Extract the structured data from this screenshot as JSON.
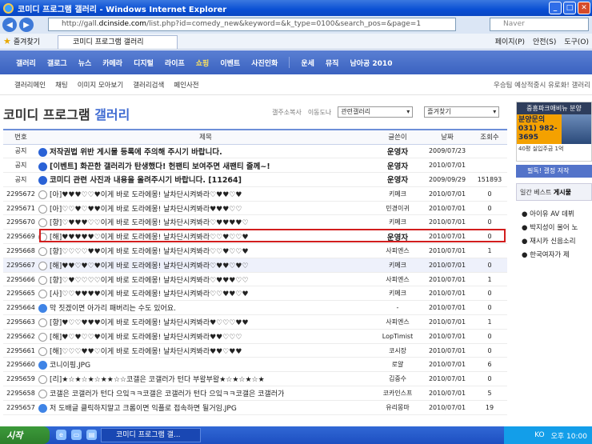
{
  "window": {
    "title": "코미디 프로그램 갤러리 - Windows Internet Explorer"
  },
  "browser": {
    "url_prefix": "http://gall.",
    "url_domain": "dcinside.com",
    "url_rest": "/list.php?id=comedy_new&keyword=&k_type=0100&search_pos=&page=1",
    "search_placeholder": "Naver",
    "favorites_label": "즐겨찾기",
    "tab_title": "코미디 프로그램 갤러리",
    "tools": [
      "페이지(P)",
      "안전(S)",
      "도구(O)"
    ]
  },
  "site_nav": {
    "items": [
      "갤러리",
      "갤로그",
      "뉴스",
      "카메라",
      "디지털",
      "라이프",
      "쇼핑",
      "이벤트",
      "사진인화",
      "운세",
      "뮤직",
      "남아공 2010"
    ],
    "highlight": "쇼핑"
  },
  "sub_nav": {
    "items": [
      "갤러리메인",
      "채팅",
      "이미지 모아보기",
      "갤러리검색",
      "페인사전"
    ],
    "right_text": "우승팀 예상적중시 유로화! 갤러리"
  },
  "gallery": {
    "title_part1": "코미디 프로그램 ",
    "title_part2": "갤러리",
    "tool_a": "갤주소복사",
    "tool_b": "이동도나",
    "related_select": "관련갤러리",
    "fav_select": "즐겨찾기"
  },
  "table": {
    "headers": [
      "번호",
      "제목",
      "글쓴이",
      "날짜",
      "조회수"
    ],
    "rows": [
      {
        "num": "공지",
        "icon": "notice",
        "subject": "저작권법 위반 게시물 등록에 주의해 주시기 바랍니다.",
        "author": "운영자",
        "date": "2009/07/23",
        "views": "",
        "notice": true
      },
      {
        "num": "공지",
        "icon": "notice",
        "subject": "[이벤트] 화끈한 갤러리가 탄생했다! 헌팬티 보여주면 새팬티 줄께~!",
        "author": "운영자",
        "date": "2010/07/01",
        "views": "",
        "notice": true
      },
      {
        "num": "공지",
        "icon": "notice",
        "subject": "코미디 관련 사진과 내용을 올려주시기 바랍니다. [11264]",
        "author": "운영자",
        "date": "2009/09/29",
        "views": "151893",
        "notice": true
      },
      {
        "num": "2295672",
        "icon": "text",
        "subject": "[아]♥♥♥♡♡♥이게 바로 도라에몽! 날차단시켜봐라♡♥♥♡♥",
        "author": "키메크",
        "date": "2010/07/01",
        "views": "0"
      },
      {
        "num": "2295671",
        "icon": "text",
        "subject": "[아]♡♡♥♡♥♥이게 바로 도라에몽! 날차단시켜봐라♥♥♥♡♡",
        "author": "민경이귀",
        "date": "2010/07/01",
        "views": "0"
      },
      {
        "num": "2295670",
        "icon": "text",
        "subject": "[향]♡♥♥♥♡♡이게 바로 도라에몽! 날차단시켜봐라♡♥♥♥♥♡",
        "author": "키메크",
        "date": "2010/07/01",
        "views": "0"
      },
      {
        "num": "2295669",
        "icon": "text",
        "subject": "[해]♥♥♥♥♥♡이게 바로 도라에몽! 날차단시켜봐라♡♡♥♡♡♥",
        "author": "운영자",
        "date": "2010/07/01",
        "views": "0",
        "bold_author": true
      },
      {
        "num": "2295668",
        "icon": "text",
        "subject": "[향]♡♡♡♡♥♥이게 바로 도라에몽! 날차단시켜봐라♡♡♥♡♡♥",
        "author": "사피엔스",
        "date": "2010/07/01",
        "views": "1"
      },
      {
        "num": "2295667",
        "icon": "text",
        "subject": "[해]♥♥♡♥♡♥이게 바로 도라에몽! 날차단시켜봐라♡♥♥♡♥♡",
        "author": "키메크",
        "date": "2010/07/01",
        "views": "0",
        "hover": true
      },
      {
        "num": "2295666",
        "icon": "text",
        "subject": "[향]♡♥♡♡♡♡이게 바로 도라에몽! 날차단시켜봐라♡♥♥♥♡♡",
        "author": "사피엔스",
        "date": "2010/07/01",
        "views": "1"
      },
      {
        "num": "2295665",
        "icon": "text",
        "subject": "[사]♡♡♥♥♥♥이게 바로 도라에몽! 날차단시켜봐라♡♡♥♥♡♥",
        "author": "키메크",
        "date": "2010/07/01",
        "views": "0"
      },
      {
        "num": "2295664",
        "icon": "pic",
        "subject": "막 짓겠이면 아가리 패버리는 수도 있어요.",
        "author": "-",
        "date": "2010/07/01",
        "views": "0"
      },
      {
        "num": "2295663",
        "icon": "text",
        "subject": "[향]♥♡♡♥♥♥이게 바로 도라에몽! 날차단시켜봐라♥♡♡♡♥♥",
        "author": "사피엔스",
        "date": "2010/07/01",
        "views": "1"
      },
      {
        "num": "2295662",
        "icon": "text",
        "subject": "[해]♥♡♥♡♡♥이게 바로 도라에몽! 날차단시켜봐라♥♥♡♡♡",
        "author": "LopTimist",
        "date": "2010/07/01",
        "views": "0"
      },
      {
        "num": "2295661",
        "icon": "text",
        "subject": "[해]♡♡♡♥♥♡이게 바로 도라에몽! 날차단시켜봐라♥♥♡♥♥",
        "author": "코시장",
        "date": "2010/07/01",
        "views": "0"
      },
      {
        "num": "2295660",
        "icon": "pic",
        "subject": "코니이핑.JPG",
        "author": "로얄",
        "date": "2010/07/01",
        "views": "6"
      },
      {
        "num": "2295659",
        "icon": "text",
        "subject": "[리]★☆★☆★☆★★☆☆코갤은 코갤러가 턴다 부왈부왈★☆★☆★☆★",
        "author": "김중수",
        "date": "2010/07/01",
        "views": "0"
      },
      {
        "num": "2295658",
        "icon": "text",
        "subject": "코갤은 코갤러가 턴다 으잌ㅋㅋ코갤은 코갤러가 턴다 으잌ㅋㅋ코갤은 코갤러가",
        "author": "코카인스프",
        "date": "2010/07/01",
        "views": "5"
      },
      {
        "num": "2295657",
        "icon": "pic",
        "subject": "저 도배글 클릭하지말고 크롬이면 익플로 접속하면 될거임.JPG",
        "author": "유리몽마",
        "date": "2010/07/01",
        "views": "19"
      }
    ]
  },
  "sidebar": {
    "ad_top": "중흥파크애비뉴 분양",
    "ad_phone_label": "분양문의",
    "ad_phone": "031) 982-3695",
    "ad_bottom": "40평 실입주금 1억",
    "notice_bar": "필독! 갤정 저작",
    "best_label": "일간 베스트",
    "best_bold": "게시물",
    "best_items": [
      "아이유 AV 데뷔",
      "박지성이 울어 노",
      "재시카 신음소리",
      "한국여자가 제"
    ]
  },
  "taskbar": {
    "start": "시작",
    "task": "코미디 프로그램 갤...",
    "lang": "KO",
    "clock": "오후 10:00"
  }
}
